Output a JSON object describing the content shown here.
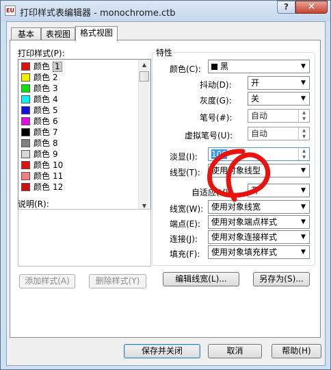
{
  "window": {
    "title": "打印样式表编辑器 - monochrome.ctb",
    "help_label": "?",
    "close_label": "✕",
    "app_icon_text": "EU"
  },
  "tabs": [
    {
      "label": "基本"
    },
    {
      "label": "表视图"
    },
    {
      "label": "格式视图"
    }
  ],
  "left": {
    "styles_label": "打印样式(P):",
    "description_label": "说明(R):",
    "styles": [
      {
        "name": "颜色",
        "num": "1",
        "color": "#e01010"
      },
      {
        "name": "颜色",
        "num": "2",
        "color": "#f0f000"
      },
      {
        "name": "颜色",
        "num": "3",
        "color": "#10e010"
      },
      {
        "name": "颜色",
        "num": "4",
        "color": "#10f0f0"
      },
      {
        "name": "颜色",
        "num": "5",
        "color": "#1010e0"
      },
      {
        "name": "颜色",
        "num": "6",
        "color": "#e010e0"
      },
      {
        "name": "颜色",
        "num": "7",
        "color": "#000000"
      },
      {
        "name": "颜色",
        "num": "8",
        "color": "#808080"
      },
      {
        "name": "颜色",
        "num": "9",
        "color": "#d8d8d8"
      },
      {
        "name": "颜色",
        "num": "10",
        "color": "#e01010"
      },
      {
        "name": "颜色",
        "num": "11",
        "color": "#f08080"
      },
      {
        "name": "颜色",
        "num": "12",
        "color": "#d01010"
      }
    ],
    "add_style": "添加样式(A)",
    "delete_style": "删除样式(Y)"
  },
  "properties": {
    "group_title": "特性",
    "color_label": "颜色(C):",
    "color_value": "黑",
    "dither_label": "抖动(D):",
    "dither_value": "开",
    "grayscale_label": "灰度(G):",
    "grayscale_value": "关",
    "pen_label": "笔号(#):",
    "pen_value": "自动",
    "virtual_pen_label": "虚拟笔号(U):",
    "virtual_pen_value": "自动",
    "screening_label": "淡显(I):",
    "screening_value": "100",
    "linetype_label": "线型(T):",
    "linetype_value": "使用对象线型",
    "adaptive_label": "自适应(V):",
    "adaptive_value": "开",
    "lineweight_label": "线宽(W):",
    "lineweight_value": "使用对象线宽",
    "endstyle_label": "端点(E):",
    "endstyle_value": "使用对象端点样式",
    "joinstyle_label": "连接(J):",
    "joinstyle_value": "使用对象连接样式",
    "fillstyle_label": "填充(F):",
    "fillstyle_value": "使用对象填充样式",
    "edit_lineweights": "编辑线宽(L)...",
    "save_as": "另存为(S)..."
  },
  "footer": {
    "save_close": "保存并关闭",
    "cancel": "取消",
    "help": "帮助(H)"
  }
}
